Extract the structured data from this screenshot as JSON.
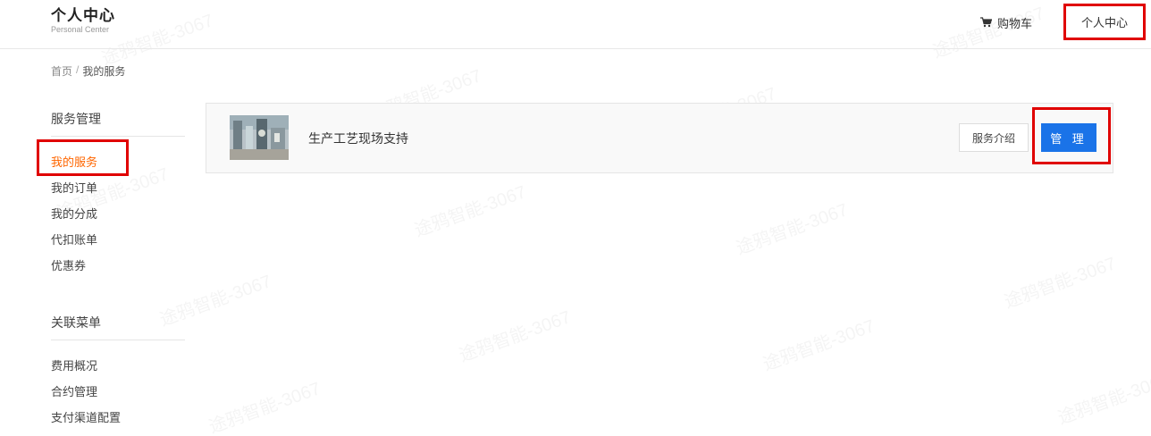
{
  "header": {
    "title": "个人中心",
    "subtitle": "Personal Center",
    "cart_label": "购物车",
    "personal_center_label": "个人中心"
  },
  "breadcrumb": {
    "home": "首页",
    "separator": "/",
    "current": "我的服务"
  },
  "sidebar": {
    "service_section": {
      "title": "服务管理",
      "items": [
        {
          "label": "我的服务",
          "active": true
        },
        {
          "label": "我的订单"
        },
        {
          "label": "我的分成"
        },
        {
          "label": "代扣账单"
        },
        {
          "label": "优惠券"
        }
      ]
    },
    "related_section": {
      "title": "关联菜单",
      "items": [
        {
          "label": "费用概况"
        },
        {
          "label": "合约管理"
        },
        {
          "label": "支付渠道配置"
        }
      ]
    }
  },
  "service_card": {
    "name": "生产工艺现场支持",
    "intro_button": "服务介绍",
    "manage_button": "管 理"
  },
  "watermark": "途鸦智能-3067",
  "colors": {
    "accent_blue": "#1a73e8",
    "active_orange": "#ff6600",
    "highlight_red": "#e00000"
  }
}
